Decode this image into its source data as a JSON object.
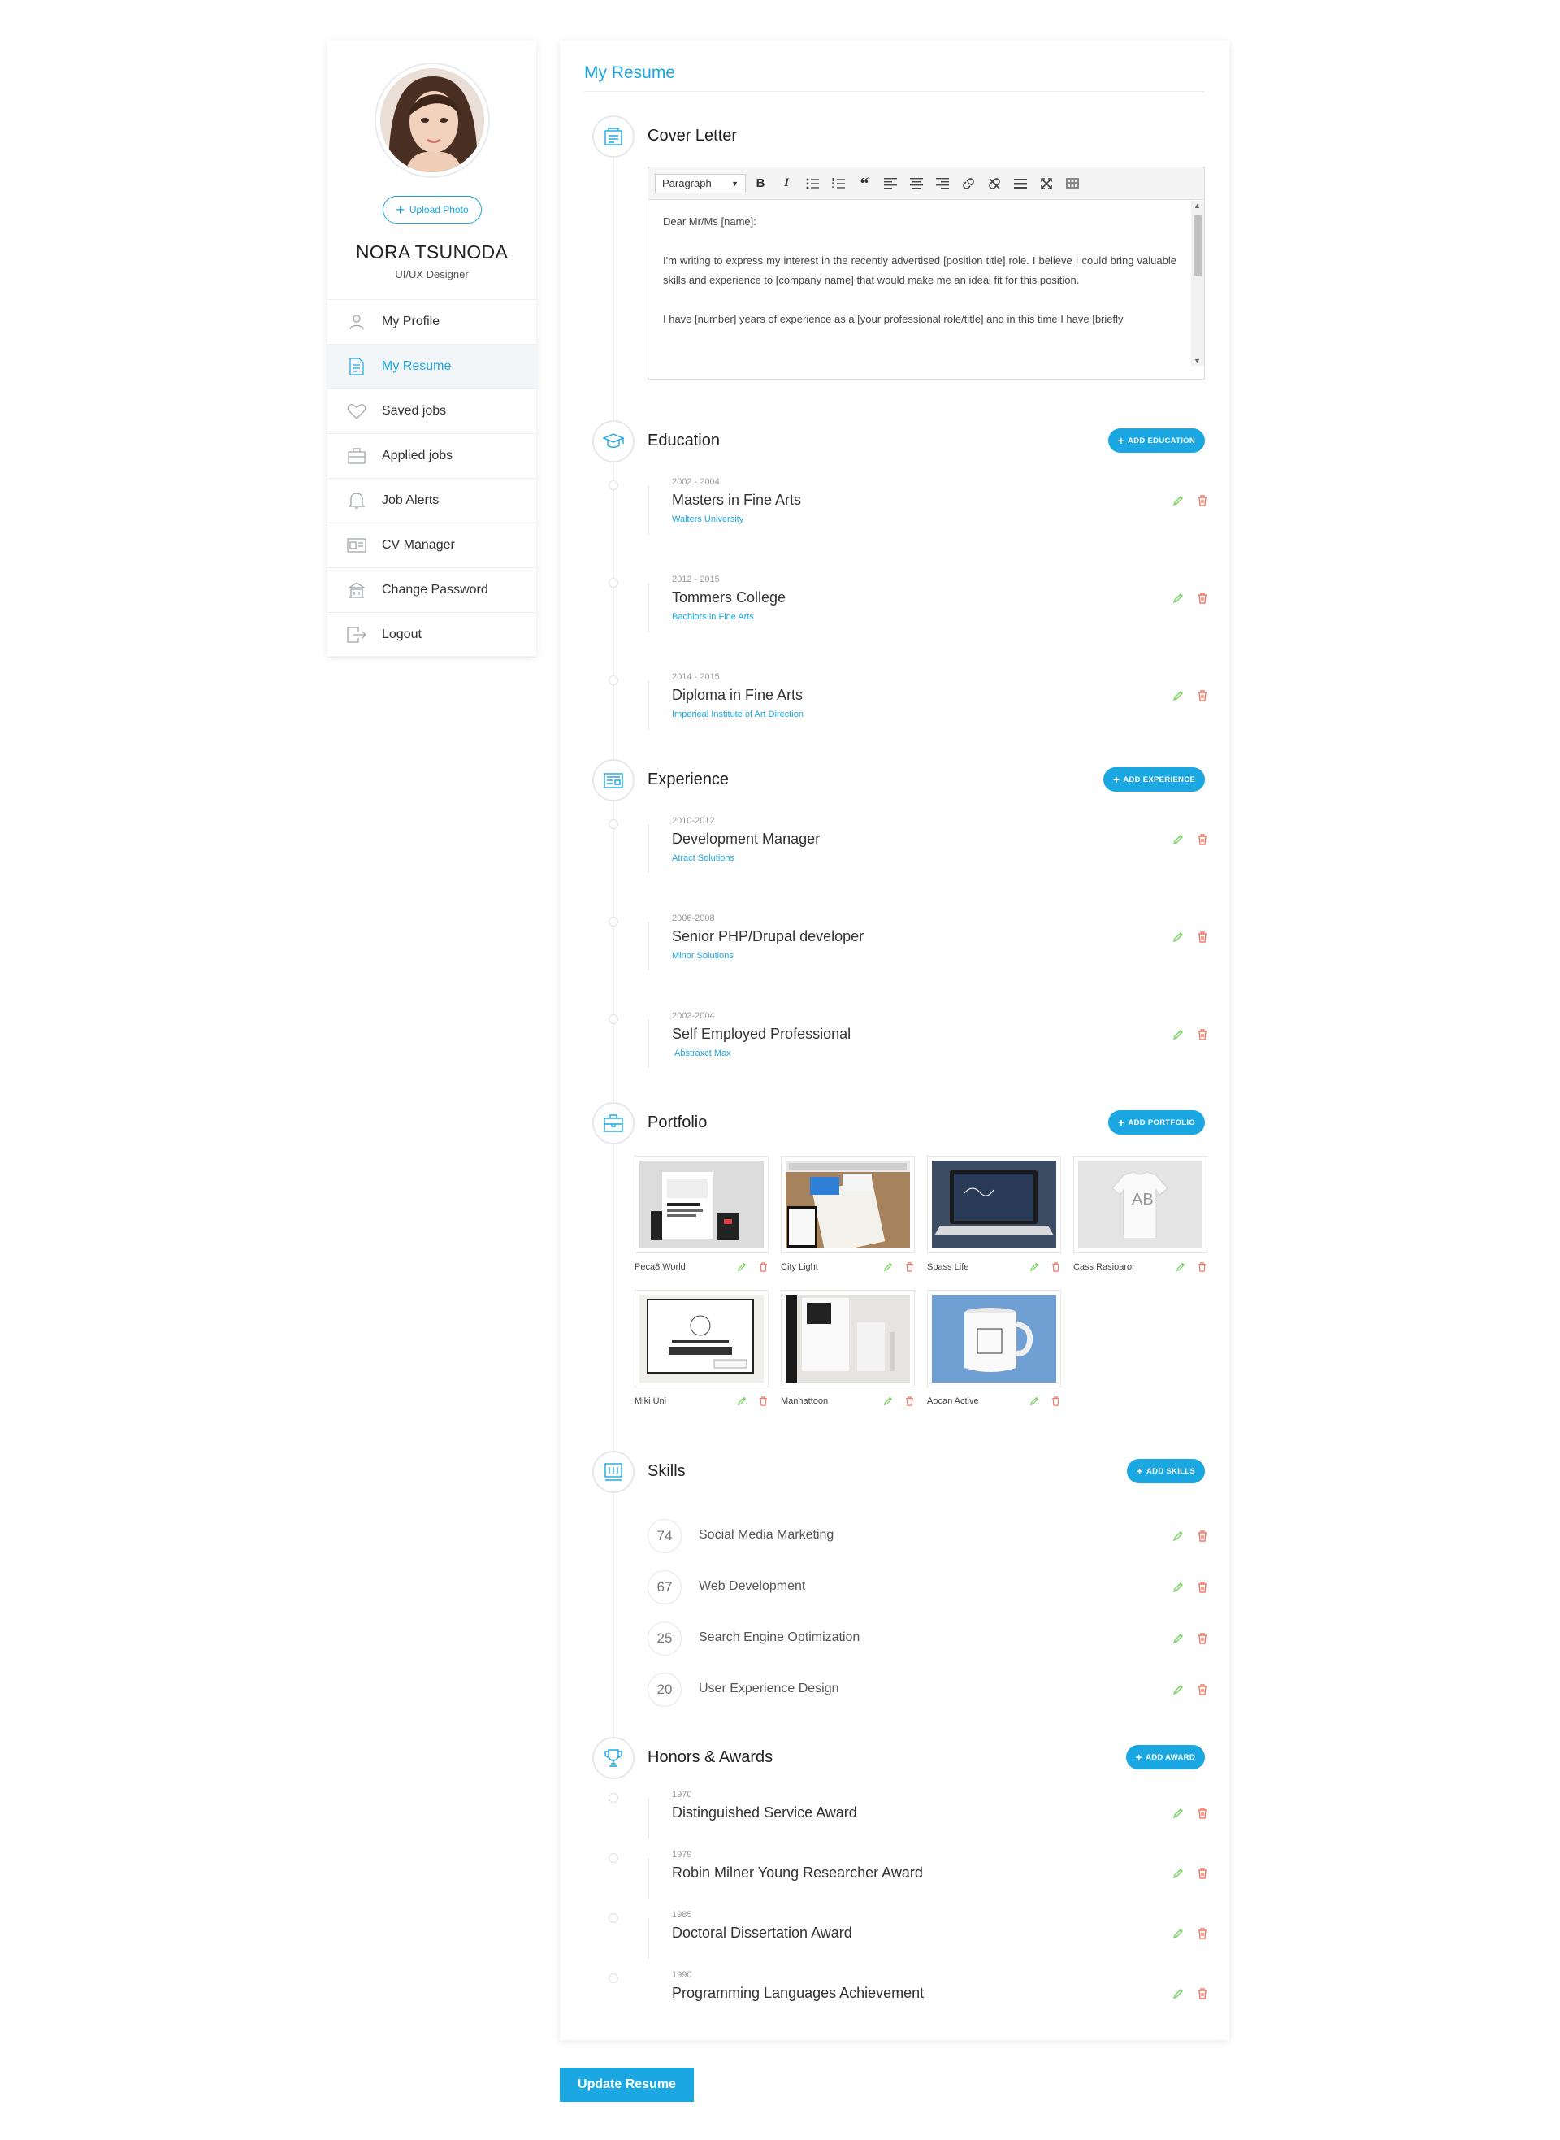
{
  "profile": {
    "upload_label": "Upload Photo",
    "name": "NORA TSUNODA",
    "title": "UI/UX Designer"
  },
  "nav": [
    {
      "label": "My Profile",
      "icon": "user-icon"
    },
    {
      "label": "My Resume",
      "icon": "resume-icon",
      "active": true
    },
    {
      "label": "Saved jobs",
      "icon": "heart-icon"
    },
    {
      "label": "Applied jobs",
      "icon": "briefcase-icon"
    },
    {
      "label": "Job Alerts",
      "icon": "bell-icon"
    },
    {
      "label": "CV Manager",
      "icon": "id-card-icon"
    },
    {
      "label": "Change Password",
      "icon": "lock-icon"
    },
    {
      "label": "Logout",
      "icon": "logout-icon"
    }
  ],
  "main": {
    "title": "My Resume"
  },
  "cover_letter": {
    "title": "Cover Letter",
    "format_select": "Paragraph",
    "paragraphs": [
      "Dear Mr/Ms [name]:",
      "I'm writing to express my interest in the recently advertised [position title] role. I believe I could bring valuable skills and experience to [company name] that would make me an ideal fit for this position.",
      "I have [number] years of experience as a [your professional role/title] and in this time I have [briefly"
    ]
  },
  "education": {
    "title": "Education",
    "add_label": "ADD EDUCATION",
    "items": [
      {
        "years": "2002 - 2004",
        "title": "Masters in Fine Arts",
        "sub": "Walters University"
      },
      {
        "years": "2012 - 2015",
        "title": "Tommers College",
        "sub": "Bachlors in Fine Arts"
      },
      {
        "years": "2014 - 2015",
        "title": "Diploma in Fine Arts",
        "sub": "Imperieal Institute of Art Direction"
      }
    ]
  },
  "experience": {
    "title": "Experience",
    "add_label": "ADD EXPERIENCE",
    "items": [
      {
        "years": "2010-2012",
        "title": "Development Manager",
        "sub": "Atract Solutions"
      },
      {
        "years": "2006-2008",
        "title": "Senior PHP/Drupal developer",
        "sub": "Minor Solutions"
      },
      {
        "years": "2002-2004",
        "title": "Self Employed Professional",
        "sub": "Abstraxct Max"
      }
    ]
  },
  "portfolio": {
    "title": "Portfolio",
    "add_label": "ADD PORTFOLIO",
    "items": [
      {
        "caption": "Peca8 World"
      },
      {
        "caption": "City Light"
      },
      {
        "caption": "Spass Life"
      },
      {
        "caption": "Cass Rasioaror"
      },
      {
        "caption": "Miki Uni"
      },
      {
        "caption": "Manhattoon"
      },
      {
        "caption": "Aocan Active"
      }
    ]
  },
  "skills": {
    "title": "Skills",
    "add_label": "ADD SKILLS",
    "items": [
      {
        "value": "74",
        "name": "Social Media Marketing"
      },
      {
        "value": "67",
        "name": "Web Development"
      },
      {
        "value": "25",
        "name": "Search Engine Optimization"
      },
      {
        "value": "20",
        "name": "User Experience Design"
      }
    ]
  },
  "awards": {
    "title": "Honors & Awards",
    "add_label": "ADD AWARD",
    "items": [
      {
        "year": "1970",
        "title": "Distinguished Service Award"
      },
      {
        "year": "1979",
        "title": "Robin Milner Young Researcher Award"
      },
      {
        "year": "1985",
        "title": "Doctoral Dissertation Award"
      },
      {
        "year": "1990",
        "title": "Programming Languages Achievement"
      }
    ]
  },
  "footer": {
    "update_label": "Update Resume"
  },
  "colors": {
    "accent": "#1ba7e2",
    "edit": "#7fd36b",
    "delete": "#f07b6b"
  }
}
